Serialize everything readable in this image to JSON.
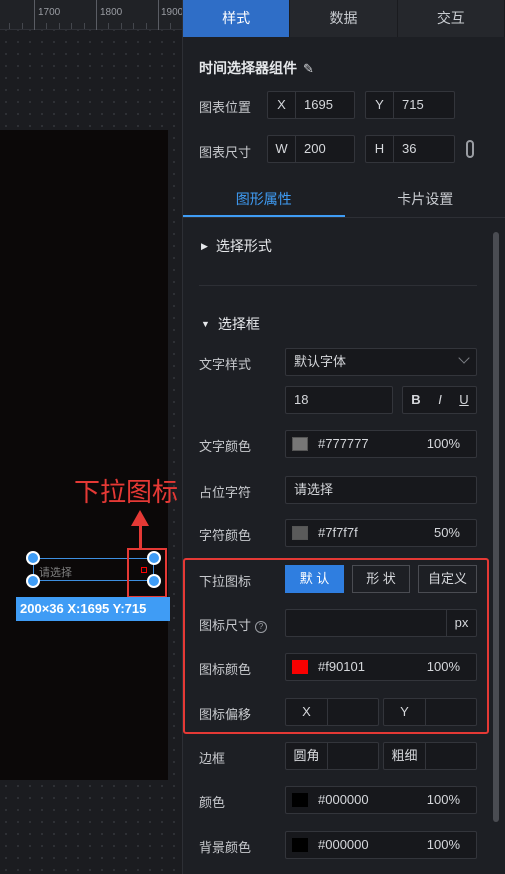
{
  "ruler": {
    "labels": [
      "1700",
      "1800",
      "1900"
    ]
  },
  "canvas": {
    "placeholder": "请选择",
    "annotation": "下拉图标",
    "info_tag": "200×36   X:1695 Y:715",
    "icon_color": "#f90101",
    "selection_color": "#3f9cf5",
    "annotation_color": "#e53935"
  },
  "tabs": [
    "样式",
    "数据",
    "交互"
  ],
  "component_title": "时间选择器组件",
  "position": {
    "label": "图表位置",
    "x_prefix": "X",
    "x": "1695",
    "y_prefix": "Y",
    "y": "715"
  },
  "size": {
    "label": "图表尺寸",
    "w_prefix": "W",
    "w": "200",
    "h_prefix": "H",
    "h": "36"
  },
  "sub_tabs": [
    "图形属性",
    "卡片设置"
  ],
  "section_form": "选择形式",
  "section_box": "选择框",
  "text_style": {
    "label": "文字样式",
    "font_value": "默认字体",
    "font_size": "18",
    "bold": "B",
    "italic": "I",
    "underline": "U"
  },
  "text_color": {
    "label": "文字颜色",
    "hex": "#777777",
    "opacity": "100%",
    "swatch": "#777777"
  },
  "placeholder_text": {
    "label": "占位字符",
    "value": "请选择"
  },
  "char_color": {
    "label": "字符颜色",
    "hex": "#7f7f7f",
    "opacity": "50%",
    "swatch": "#5a5a5a"
  },
  "dropdown_icon": {
    "label": "下拉图标",
    "buttons": [
      "默 认",
      "形 状",
      "自定义"
    ]
  },
  "icon_size": {
    "label": "图标尺寸",
    "unit": "px",
    "value": ""
  },
  "icon_color": {
    "label": "图标颜色",
    "hex": "#f90101",
    "opacity": "100%",
    "swatch": "#f90101"
  },
  "icon_offset": {
    "label": "图标偏移",
    "x": "X",
    "y": "Y"
  },
  "border": {
    "label": "边框",
    "radius": "圆角",
    "width": "粗细"
  },
  "color": {
    "label": "颜色",
    "hex": "#000000",
    "opacity": "100%",
    "swatch": "#000000"
  },
  "bg_color": {
    "label": "背景颜色",
    "hex": "#000000",
    "opacity": "100%",
    "swatch": "#000000"
  }
}
